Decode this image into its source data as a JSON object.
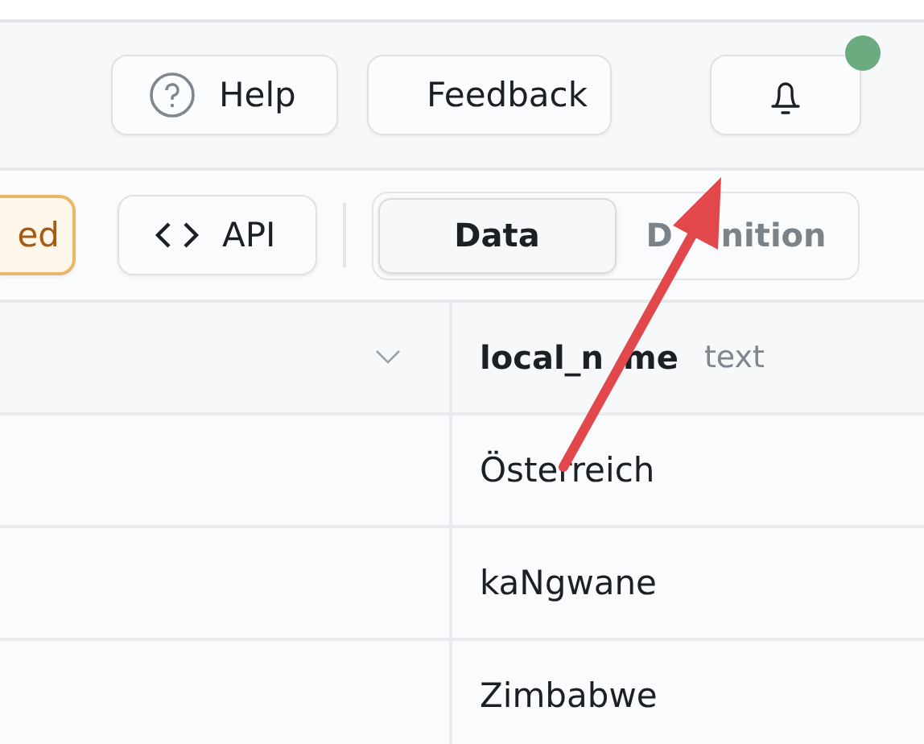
{
  "header": {
    "help_button": "Help",
    "feedback_button": "Feedback",
    "notifications": {
      "unread": true
    }
  },
  "toolbar": {
    "status_button": "ed",
    "api_button": "API",
    "view_tabs": [
      {
        "label": "Data",
        "selected": true
      },
      {
        "label_parts": [
          "D",
          "nition"
        ],
        "selected": false
      }
    ]
  },
  "table": {
    "columns": [
      {
        "name_parts": [
          "local_n",
          "me"
        ],
        "type": "text"
      }
    ],
    "rows": [
      {
        "local_name": "Österreich"
      },
      {
        "local_name": "kaNgwane"
      },
      {
        "local_name": "Zimbabwe"
      }
    ]
  }
}
